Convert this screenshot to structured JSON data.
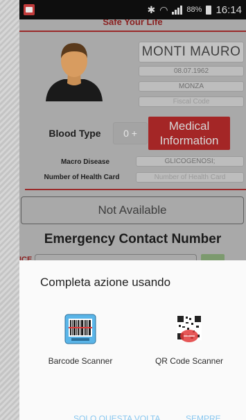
{
  "status_bar": {
    "battery_pct": "88%",
    "time": "16:14"
  },
  "app": {
    "header_text": "Safe Your Life"
  },
  "profile": {
    "name": "MONTI MAURO",
    "birth_date": "08.07.1962",
    "city": "MONZA",
    "fiscal_code_placeholder": "Fiscal Code"
  },
  "medical": {
    "blood_type_label": "Blood Type",
    "blood_type_value": "0 +",
    "medical_info_button": "Medical Information",
    "macro_disease_label": "Macro Disease",
    "macro_disease_value": "GLICOGENOSI;",
    "health_card_label": "Number of Health Card",
    "health_card_placeholder": "Number of Health Card"
  },
  "availability": "Not Available",
  "emergency": {
    "title": "Emergency Contact Number",
    "ice_label": "ICE"
  },
  "sheet": {
    "title": "Completa azione usando",
    "apps": [
      {
        "label": "Barcode Scanner",
        "icon": "barcode-scanner-icon"
      },
      {
        "label": "QR Code Scanner",
        "icon": "qr-code-scanner-icon"
      }
    ],
    "just_once": "SOLO QUESTA VOLTA",
    "always": "SEMPRE"
  },
  "colors": {
    "accent_red": "#a42626",
    "sheet_button": "#88c7f0"
  }
}
